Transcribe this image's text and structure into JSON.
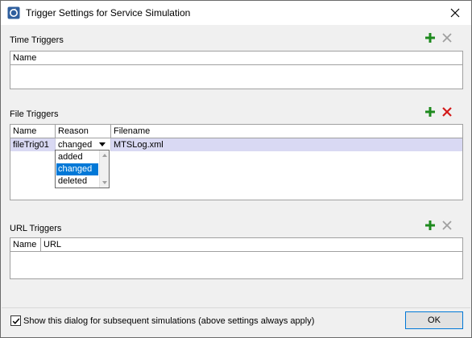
{
  "window": {
    "title": "Trigger Settings for Service Simulation"
  },
  "time_triggers": {
    "label": "Time Triggers",
    "columns": [
      "Name"
    ]
  },
  "file_triggers": {
    "label": "File Triggers",
    "columns": [
      "Name",
      "Reason",
      "Filename"
    ],
    "rows": [
      {
        "name": "fileTrig01",
        "reason": "changed",
        "filename": "MTSLog.xml"
      }
    ],
    "reason_options": [
      "added",
      "changed",
      "deleted"
    ],
    "selected_option": "changed"
  },
  "url_triggers": {
    "label": "URL Triggers",
    "columns": [
      "Name",
      "URL"
    ]
  },
  "footer": {
    "checkbox_label": "Show this dialog for subsequent simulations (above settings always apply)",
    "checkbox_checked": true,
    "ok_label": "OK"
  },
  "colors": {
    "add_green": "#1e8a1e",
    "delete_red": "#d31a1a",
    "disabled_gray": "#a0a0a0",
    "selection_blue": "#0078d7",
    "row_highlight": "#d9d9f3"
  }
}
